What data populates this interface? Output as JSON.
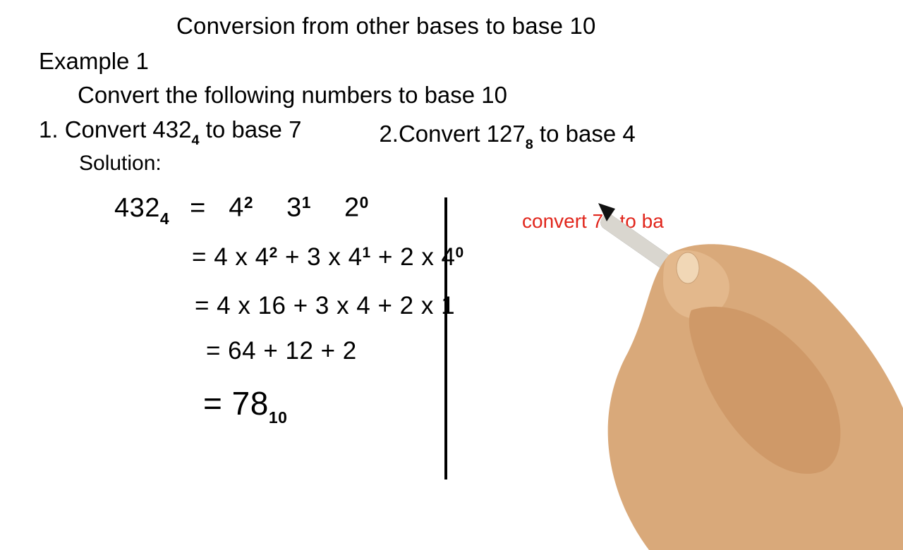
{
  "title": "Conversion from other bases to base 10",
  "exampleLabel": "Example 1",
  "subtitle": "Convert the following numbers to base 10",
  "problem1": {
    "prefix": "1. Convert 432",
    "sub": "4",
    "suffix": " to base 7"
  },
  "problem2": {
    "prefix": "2.Convert 127",
    "sub": "8",
    "suffix": " to base 4"
  },
  "solutionLabel": "Solution:",
  "step1": {
    "lhsNum": "432",
    "lhsSub": "4",
    "eq": "=",
    "t1b": "4",
    "t1e": "2",
    "t2b": "3",
    "t2e": "1",
    "t3b": "2",
    "t3e": "0"
  },
  "step2": {
    "eq": "=",
    "a": "4 x 4",
    "ae": "2",
    "b": "+ 3 x 4",
    "be": "1",
    "c": "+ 2 x 4",
    "ce": "0"
  },
  "step3": {
    "text": "= 4 x 16 + 3 x 4 + 2 x 1"
  },
  "step4": {
    "text": "= 64 + 12 + 2"
  },
  "step5": {
    "eq": "= ",
    "num": "78",
    "sub": "10"
  },
  "redNote": "convert 78 to ba"
}
